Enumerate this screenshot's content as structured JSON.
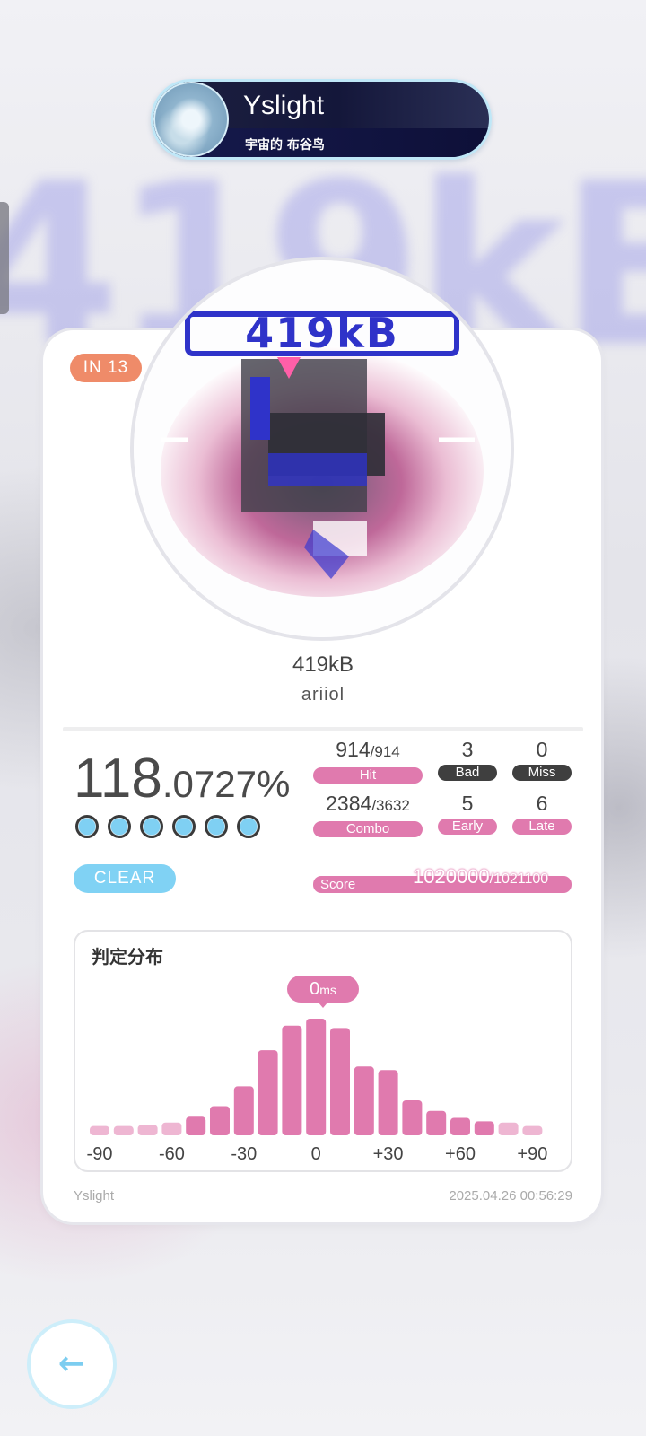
{
  "player": {
    "name": "Yslight",
    "title": "宇宙的 布谷鸟"
  },
  "chart_level": "IN  13",
  "song": {
    "title": "419kB",
    "artist": "ariiol",
    "jacket_text": "419kB"
  },
  "result": {
    "accuracy_int": "118",
    "accuracy_dec": ".0727%",
    "dots_count": 6,
    "status": "CLEAR"
  },
  "stats": {
    "hit": {
      "value": "914",
      "max": "/914",
      "label": "Hit"
    },
    "bad": {
      "value": "3",
      "label": "Bad"
    },
    "miss": {
      "value": "0",
      "label": "Miss"
    },
    "combo": {
      "value": "2384",
      "max": "/3632",
      "label": "Combo"
    },
    "early": {
      "value": "5",
      "label": "Early"
    },
    "late": {
      "value": "6",
      "label": "Late"
    },
    "score": {
      "label": "Score",
      "value": "1020000",
      "max": "/1021100"
    }
  },
  "distribution": {
    "title": "判定分布",
    "peak_value": "0",
    "peak_unit": "ms"
  },
  "chart_data": {
    "type": "bar",
    "title": "判定分布",
    "xlabel": "",
    "ylabel": "",
    "tick_labels": [
      "-90",
      "-60",
      "-30",
      "0",
      "+30",
      "+60",
      "+90"
    ],
    "x": [
      -90,
      -80,
      -70,
      -60,
      -50,
      -40,
      -30,
      -20,
      -10,
      0,
      10,
      20,
      30,
      40,
      50,
      60,
      70,
      80,
      90
    ],
    "values": [
      0.08,
      0.08,
      0.09,
      0.11,
      0.16,
      0.25,
      0.42,
      0.73,
      0.94,
      1.0,
      0.92,
      0.59,
      0.56,
      0.3,
      0.21,
      0.15,
      0.12,
      0.11,
      0.08
    ],
    "colors": {
      "strong": "#e07aae",
      "faint": "#eeb6d2"
    }
  },
  "footer": {
    "player": "Yslight",
    "timestamp": "2025.04.26 00:56:29"
  },
  "icons": {
    "back": "arrow-left-icon"
  }
}
